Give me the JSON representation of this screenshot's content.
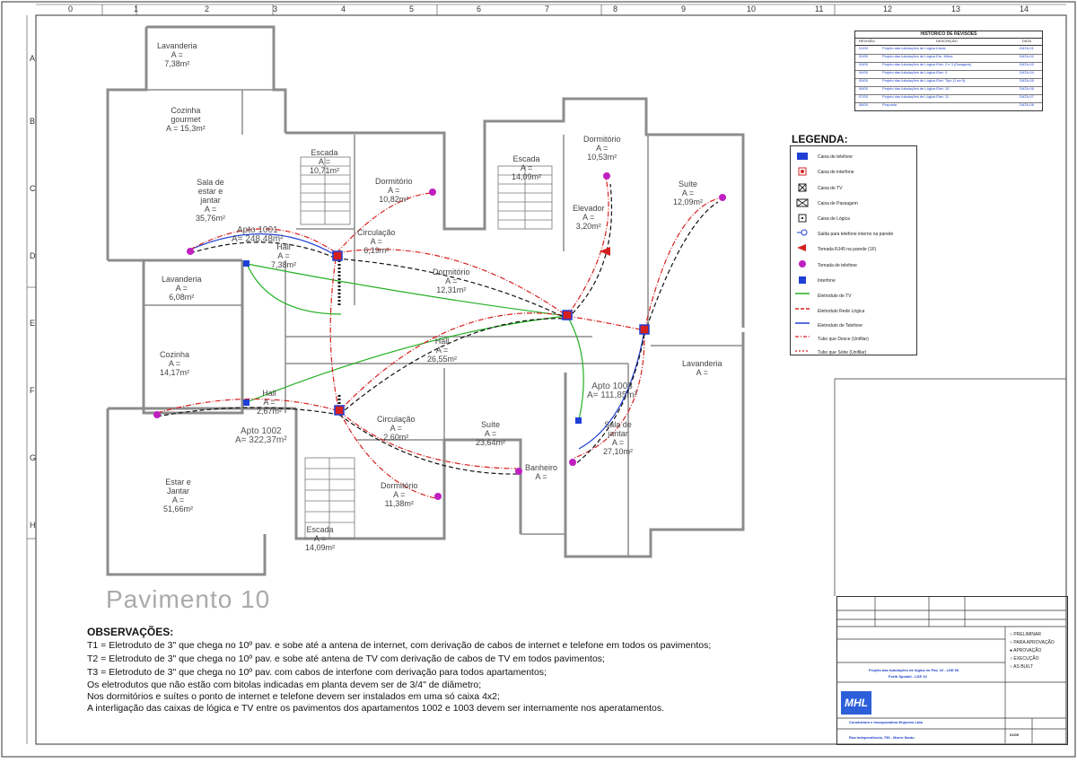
{
  "sheet": {
    "column_numbers": [
      "0",
      "1",
      "2",
      "3",
      "4",
      "5",
      "6",
      "7",
      "8",
      "9",
      "10",
      "11",
      "12",
      "13",
      "14"
    ],
    "row_letters": [
      "A",
      "B",
      "C",
      "D",
      "E",
      "F",
      "G",
      "H"
    ]
  },
  "plan": {
    "title": "Pavimento 10",
    "rooms": [
      {
        "key": "lavanderia1",
        "text": "Lavanderia\nA =\n7,38m²"
      },
      {
        "key": "cozinha1",
        "text": "Cozinha\ngourmet\nA = 15,3m²"
      },
      {
        "key": "sala1",
        "text": "Sala de\nestar e\njantar\nA =\n35,76m²"
      },
      {
        "key": "apto1001",
        "text": "Apto 1001\nA= 248,48m²"
      },
      {
        "key": "hall1",
        "text": "Hall\nA =\n7,38m²"
      },
      {
        "key": "escada1",
        "text": "Escada\nA =\n10,71m²"
      },
      {
        "key": "dorm1",
        "text": "Dormitório\nA =\n10,82m²"
      },
      {
        "key": "circ1",
        "text": "Circulação\nA =\n6,19m²"
      },
      {
        "key": "dorm2",
        "text": "Dormitório\nA =\n12,31m²"
      },
      {
        "key": "escada2",
        "text": "Escada\nA =\n14,09m²"
      },
      {
        "key": "dorm3",
        "text": "Dormitório\nA =\n10,53m²"
      },
      {
        "key": "elevador",
        "text": "Elevador\nA =\n3,20m²"
      },
      {
        "key": "suite1",
        "text": "Suíte\nA =\n12,09m²"
      },
      {
        "key": "lavanderia2",
        "text": "Lavanderia\nA =\n6,08m²"
      },
      {
        "key": "cozinha2",
        "text": "Cozinha\nA =\n14,17m²"
      },
      {
        "key": "hall2",
        "text": "Hall\nA =\n26,55m²"
      },
      {
        "key": "hall3",
        "text": "Hall\nA =\n2,67m²"
      },
      {
        "key": "apto1002",
        "text": "Apto 1002\nA= 322,37m²"
      },
      {
        "key": "circ2",
        "text": "Circulação\nA =\n2,60m²"
      },
      {
        "key": "suite2",
        "text": "Suíte\nA =\n23,64m²"
      },
      {
        "key": "apto1003",
        "text": "Apto 1003\nA= 111,85m²"
      },
      {
        "key": "sala2",
        "text": "Sala de\njantar\nA =\n27,10m²"
      },
      {
        "key": "lavanderia3",
        "text": "Lavanderia\nA ="
      },
      {
        "key": "estar2",
        "text": "Estar e\nJantar\nA =\n51,66m²"
      },
      {
        "key": "dorm4",
        "text": "Dormitório\nA =\n11,38m²"
      },
      {
        "key": "escada3",
        "text": "Escada\nA =\n14,09m²"
      },
      {
        "key": "banheiro",
        "text": "Banheiro\nA ="
      }
    ]
  },
  "observations": {
    "title": "OBSERVAÇÕES:",
    "lines": [
      "T1 = Eletroduto de 3\" que chega no 10º pav. e sobe até a antena de internet, com derivação de cabos de internet e telefone em todos os pavimentos;",
      "T2 = Eletroduto de 3\" que chega no 10º pav. e sobe até antena de TV com derivação de cabos de TV em todos pavimentos;",
      "T3 = Eletroduto de 3\" que chega no 10º pav. com cabos de interfone com derivação para todos apartamentos;",
      "Os eletrodutos que não estão com bitolas indicadas em planta devem ser de 3/4\" de diâmetro;",
      "Nos dormitórios e suítes o ponto de internet e telefone devem ser instalados em uma só caixa 4x2;",
      "A interligação das caixas de lógica e TV entre os pavimentos dos apartamentos 1002 e 1003 devem ser internamente nos aperatamentos."
    ]
  },
  "legend": {
    "title": "LEGENDA:",
    "items": [
      {
        "icon": "telephone-box-icon",
        "label": "Caixa de telefone",
        "color": "#1f3fd6"
      },
      {
        "icon": "intercom-box-icon",
        "label": "Caixa de interfone",
        "color": "#d62020"
      },
      {
        "icon": "tv-box-icon",
        "label": "Caixa de TV",
        "color": "#222222"
      },
      {
        "icon": "pass-box-icon",
        "label": "Caixa de Passagem",
        "color": "#222222"
      },
      {
        "icon": "logic-box-icon",
        "label": "Caixa de Lógica",
        "color": "#222222"
      },
      {
        "icon": "wall-phone-outlet-icon",
        "label": "Saída para telefone interno na parede",
        "color": "#1f3fd6"
      },
      {
        "icon": "rj45-outlet-icon",
        "label": "Tomada RJ45 na parede (1F)",
        "color": "#d62020"
      },
      {
        "icon": "phone-outlet-icon",
        "label": "Tomada de telefone",
        "color": "#c020c0"
      },
      {
        "icon": "intercom-icon",
        "label": "Interfone",
        "color": "#1f3fd6"
      },
      {
        "icon": "tv-conduit-line",
        "label": "Eletroduto de TV",
        "color": "#22b022"
      },
      {
        "icon": "logic-conduit-line",
        "label": "Eletroduto Rede Lógica",
        "color": "#d62020"
      },
      {
        "icon": "phone-conduit-line",
        "label": "Eletroduto de Telefone",
        "color": "#1f3fd6"
      },
      {
        "icon": "pipe-down-icon",
        "label": "Tubo que Desce (Unifilar)",
        "color": "#d62020"
      },
      {
        "icon": "pipe-up-icon",
        "label": "Tubo que Sobe (Unifilar)",
        "color": "#d62020"
      }
    ]
  },
  "revisions": {
    "title": "HISTÓRICO DE REVISÕES",
    "columns": [
      "REVISÃO",
      "DESCRIÇÃO",
      "DATA"
    ],
    "rows": [
      {
        "rev": "01/00",
        "desc": "Projeto das tubulações de Lógica Inicial",
        "date": "DATA-01"
      },
      {
        "rev": "02/00",
        "desc": "Projeto das tubulações de Lógica Em. Mirna",
        "date": "DATA-02"
      },
      {
        "rev": "03/00",
        "desc": "Projeto das tubulações de Lógica Elev. 2 e 3 (Garagem)",
        "date": "DATA-03"
      },
      {
        "rev": "04/00",
        "desc": "Projeto das tubulações de Lógica Elev. 4",
        "date": "DATA-04"
      },
      {
        "rev": "05/00",
        "desc": "Projeto das tubulações de Lógica Elev. Tipo (1 ao 9)",
        "date": "DATA-05"
      },
      {
        "rev": "06/00",
        "desc": "Projeto das tubulações de Lógica Elev. 10",
        "date": "DATA-06"
      },
      {
        "rev": "07/00",
        "desc": "Projeto das tubulações de Lógica Elev. 11",
        "date": "DATA-07"
      },
      {
        "rev": "08/00",
        "desc": "Proposta",
        "date": "DATA-08"
      }
    ]
  },
  "titleblock": {
    "project_line1": "Projeto das tubulações de lógica no Pav. 10 - LDE 06",
    "project_line2": "Forth Spedali - LDE 10",
    "owner": "Construtora e Incorporadora Enjuvem Ltda",
    "address": "Rua Independência, 750 - Morro Santo",
    "logo": "MHL",
    "options": [
      "PRELIMINAR",
      "PARA APROVAÇÃO",
      "APROVAÇÃO",
      "EXECUÇÃO",
      "AS BUILT"
    ],
    "sheet_no": "01/05"
  },
  "colors": {
    "wall": "#8c8c8c",
    "logic": "#d62020",
    "phone": "#1f3fd6",
    "tv": "#22b022",
    "blackdash": "#111111"
  }
}
